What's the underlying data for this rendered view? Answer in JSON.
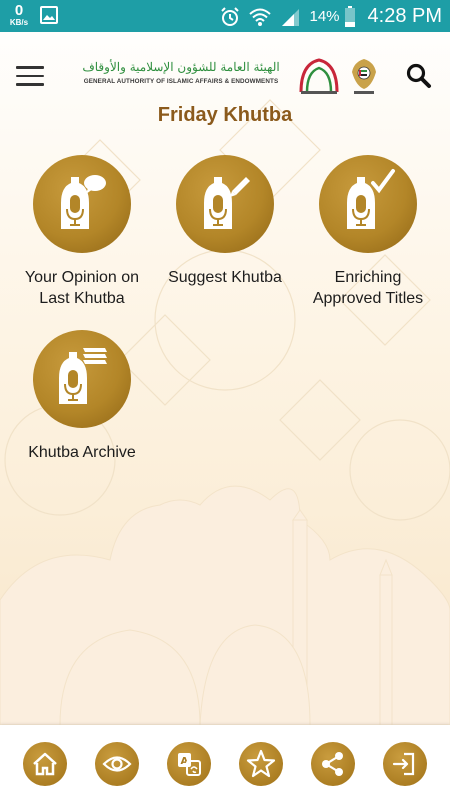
{
  "status_bar": {
    "net_speed": "0",
    "net_unit": "KB/s",
    "battery_percent": "14%",
    "time": "4:28 PM",
    "icons": [
      "gallery-icon",
      "alarm-icon",
      "wifi-icon",
      "signal-icon",
      "battery-icon"
    ]
  },
  "header": {
    "logo_arabic": "الهيئة العامة للشؤون الإسلامية والأوقاف",
    "logo_english": "GENERAL AUTHORITY OF ISLAMIC AFFAIRS & ENDOWMENTS",
    "menu_icon": "hamburger-menu-icon",
    "search_icon": "search-icon"
  },
  "page_title": "Friday Khutba",
  "tiles": [
    {
      "label_line1": "Your Opinion on",
      "label_line2": "Last Khutba",
      "icon": "opinion-icon"
    },
    {
      "label_line1": "Suggest Khutba",
      "label_line2": "",
      "icon": "suggest-icon"
    },
    {
      "label_line1": "Enriching",
      "label_line2": "Approved Titles",
      "icon": "approved-icon"
    },
    {
      "label_line1": "Khutba Archive",
      "label_line2": "",
      "icon": "archive-icon"
    }
  ],
  "bottom_nav": [
    "home-icon",
    "eye-icon",
    "translate-icon",
    "star-icon",
    "share-icon",
    "logout-icon"
  ],
  "colors": {
    "status_bar": "#1e9ea6",
    "gold": "#b38628",
    "title_brown": "#8b5a1c",
    "background": "#fdf6ea"
  }
}
